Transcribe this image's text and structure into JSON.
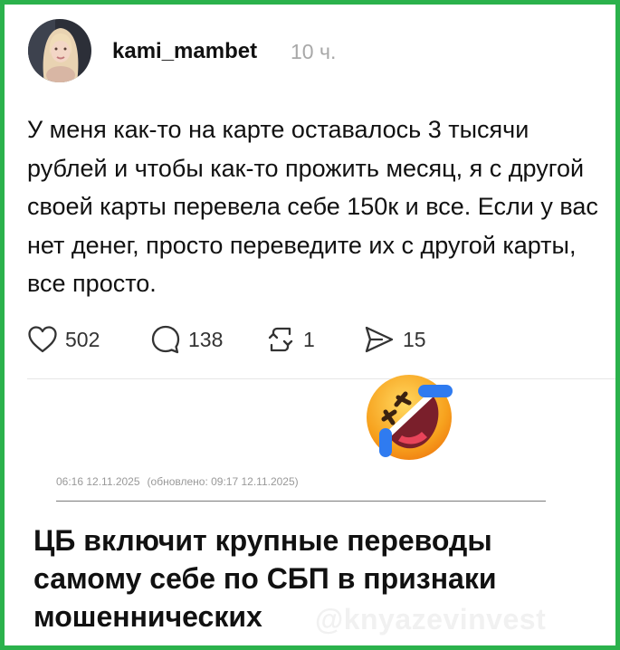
{
  "post": {
    "username": "kami_mambet",
    "time": "10 ч.",
    "text": "У меня как-то на карте оставалось 3 тысячи рублей и чтобы как-то прожить месяц, я с другой своей карты перевела себе 150к и все. Если у вас нет денег, просто переведите их с другой карты, все просто."
  },
  "actions": {
    "likes": "502",
    "comments": "138",
    "reposts": "1",
    "shares": "15"
  },
  "article": {
    "published": "06:16 12.11.2025",
    "updated": "(обновлено: 09:17 12.11.2025)",
    "headline": "ЦБ включит крупные переводы самому себе по СБП в признаки мошеннических"
  },
  "watermark": "@knyazevinvest",
  "colors": {
    "frame": "#2bb24c",
    "muted_text": "#a8a8a8"
  },
  "icons": {
    "like": "heart-icon",
    "comment": "comment-bubble-icon",
    "repost": "repost-icon",
    "share": "send-icon",
    "emoji": "rolling-on-floor-laughing-emoji"
  }
}
